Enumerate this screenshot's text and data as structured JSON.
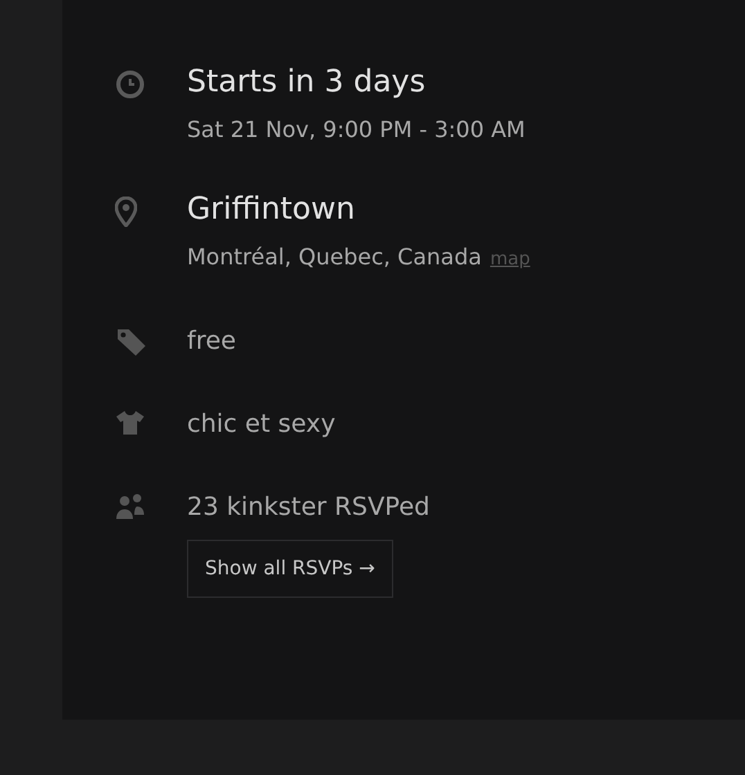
{
  "details": [
    {
      "kind": "clock",
      "title": "Starts in 3 days",
      "subtitle": "Sat 21 Nov, 9:00 PM - 3:00 AM"
    },
    {
      "kind": "pin",
      "title": "Griffintown",
      "subtitle": "Montréal, Quebec, Canada",
      "link": "map"
    },
    {
      "kind": "tag",
      "text": "free"
    },
    {
      "kind": "shirt",
      "text": "chic et sexy"
    },
    {
      "kind": "people",
      "text": "23 kinkster RSVPed",
      "button": "Show all RSVPs →"
    }
  ]
}
